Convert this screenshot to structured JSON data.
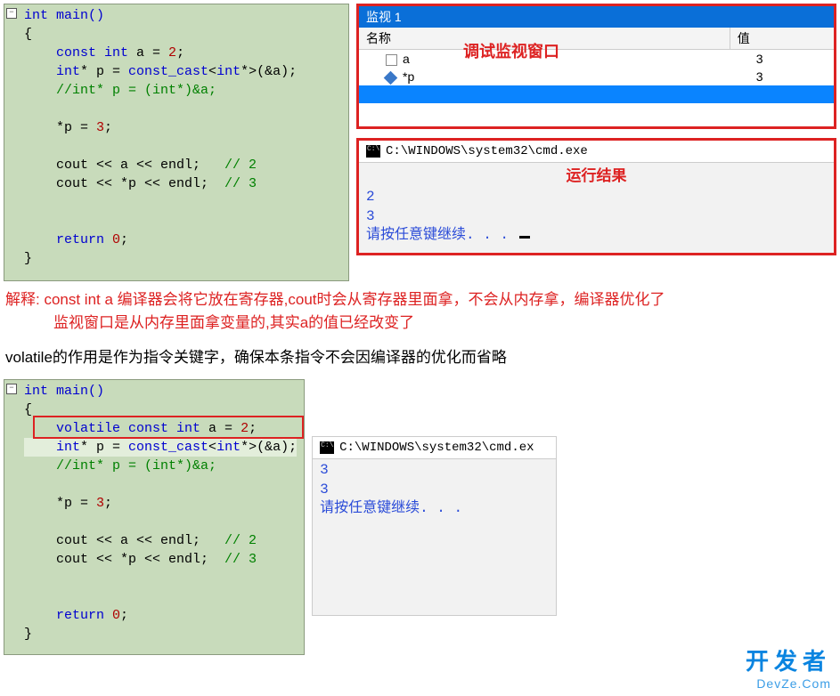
{
  "code1": {
    "sig": "int main()",
    "open": "{",
    "l1a": "    const int",
    "l1b": " a = ",
    "l1num": "2",
    "l1c": ";",
    "l2a": "    int",
    "l2b": "* p = ",
    "l2c": "const_cast",
    "l2d": "<",
    "l2e": "int",
    "l2f": "*>(&a);",
    "l3": "    //int* p = (int*)&a;",
    "l4a": "    *p = ",
    "l4num": "3",
    "l4b": ";",
    "l5a": "    cout << a << endl;   ",
    "l5c": "// 2",
    "l6a": "    cout << *p << endl;  ",
    "l6c": "// 3",
    "l7a": "    return ",
    "l7num": "0",
    "l7b": ";",
    "close": "}"
  },
  "watch": {
    "title": "监视 1",
    "annot": "调试监视窗口",
    "colName": "名称",
    "colVal": "值",
    "rows": [
      {
        "name": "a",
        "val": "3"
      },
      {
        "name": "*p",
        "val": "3"
      }
    ]
  },
  "cmd1": {
    "title": "C:\\WINDOWS\\system32\\cmd.exe",
    "annot": "运行结果",
    "out1": "2",
    "out2": "3",
    "prompt": "请按任意键继续. . . "
  },
  "explain": {
    "l1": "解释: const int a 编译器会将它放在寄存器,cout时会从寄存器里面拿，不会从内存拿，编译器优化了",
    "l2": "监视窗口是从内存里面拿变量的,其实a的值已经改变了"
  },
  "note": "volatile的作用是作为指令关键字，确保本条指令不会因编译器的优化而省略",
  "code2": {
    "sig": "int main()",
    "open": "{",
    "l1a": "    volatile const int",
    "l1b": " a = ",
    "l1num": "2",
    "l1c": ";",
    "l2a": "    int",
    "l2b": "* p = ",
    "l2c": "const_cast",
    "l2d": "<",
    "l2e": "int",
    "l2f": "*>(&a);",
    "l3": "    //int* p = (int*)&a;",
    "l4a": "    *p = ",
    "l4num": "3",
    "l4b": ";",
    "l5a": "    cout << a << endl;   ",
    "l5c": "// 2",
    "l6a": "    cout << *p << endl;  ",
    "l6c": "// 3",
    "l7a": "    return ",
    "l7num": "0",
    "l7b": ";",
    "close": "}"
  },
  "cmd2": {
    "title": "C:\\WINDOWS\\system32\\cmd.ex",
    "out1": "3",
    "out2": "3",
    "prompt": "请按任意键继续. . ."
  },
  "watermark": {
    "big": "开发者",
    "small": "DevZe.Com"
  }
}
